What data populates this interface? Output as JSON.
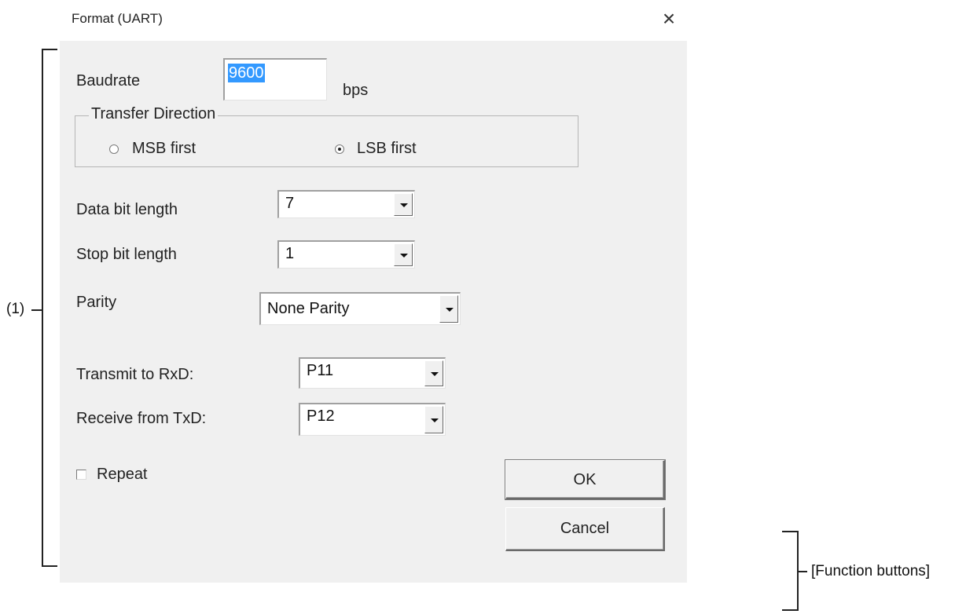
{
  "dialog": {
    "title": "Format (UART)",
    "close_glyph": "×"
  },
  "baudrate": {
    "label": "Baudrate",
    "value": "9600",
    "unit": "bps"
  },
  "transfer_direction": {
    "group_label": "Transfer Direction",
    "options": [
      {
        "label": "MSB first",
        "selected": false
      },
      {
        "label": "LSB first",
        "selected": true
      }
    ]
  },
  "data_bit_length": {
    "label": "Data bit length",
    "value": "7"
  },
  "stop_bit_length": {
    "label": "Stop bit length",
    "value": "1"
  },
  "parity": {
    "label": "Parity",
    "value": "None Parity"
  },
  "transmit_to_rxd": {
    "label": "Transmit to RxD:",
    "value": "P11"
  },
  "receive_from_txd": {
    "label": "Receive from TxD:",
    "value": "P12"
  },
  "repeat": {
    "label": "Repeat",
    "checked": false
  },
  "buttons": {
    "ok": "OK",
    "cancel": "Cancel"
  },
  "annotations": {
    "area_1": "(1)",
    "function_buttons": "[Function buttons]"
  },
  "icons": {
    "close": "close-icon",
    "dropdown": "chevron-down-icon",
    "radio": "radio-icon",
    "checkbox": "checkbox-icon"
  }
}
